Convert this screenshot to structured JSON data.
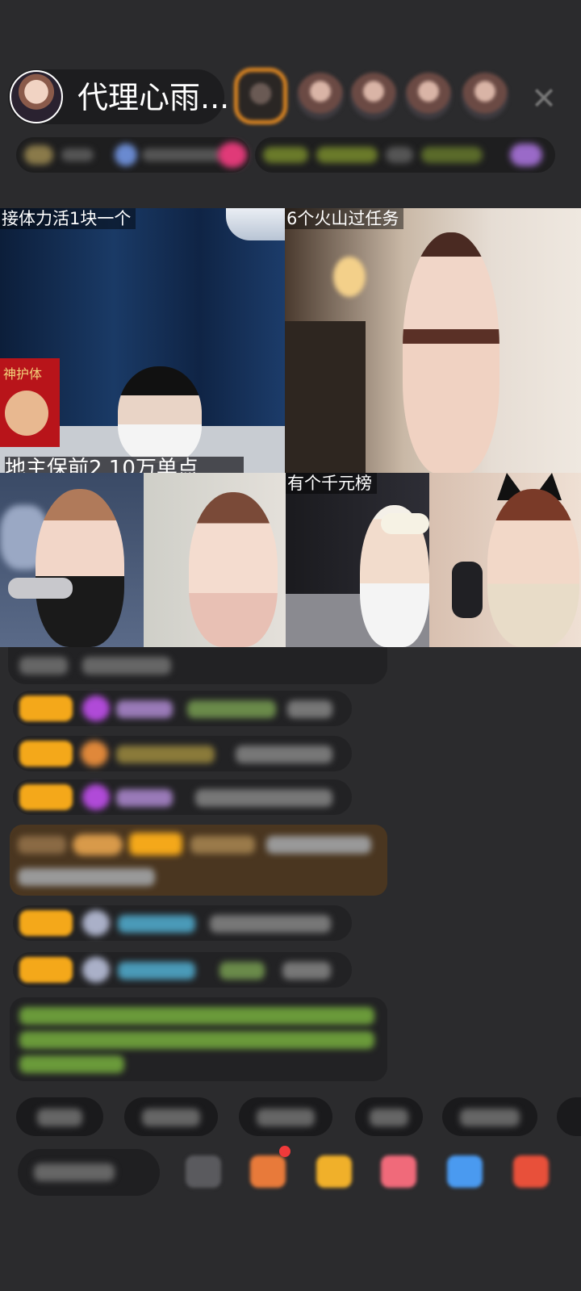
{
  "header": {
    "host_name": "代理心雨...",
    "close_icon": "close-icon"
  },
  "video_grid": {
    "tiles": [
      {
        "caption": "接体力活1块一个",
        "overlay": "地主保前2 10万单点",
        "banner": "神护体"
      },
      {
        "caption": "6个火山过任务"
      },
      {
        "caption": ""
      },
      {
        "caption": ""
      },
      {
        "caption": "有个千元榜"
      },
      {
        "caption": ""
      }
    ]
  },
  "colors": {
    "background": "#2b2b2d",
    "badge": "#f4a81a",
    "chat_row": "#222224",
    "top_viewer_ring": "#e48a22",
    "highlight_row": "#4a3620",
    "system_message": "#7fb84a"
  }
}
